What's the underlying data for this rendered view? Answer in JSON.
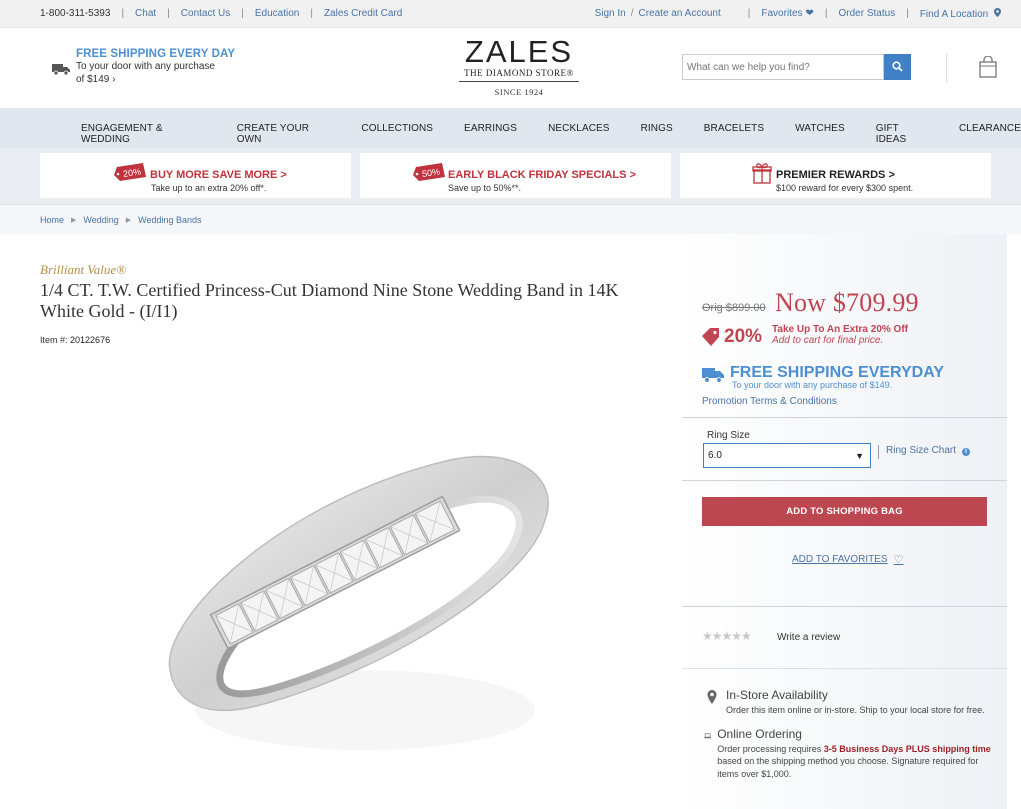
{
  "utility": {
    "phone": "1-800-311-5393",
    "links_left": [
      "Chat",
      "Contact Us",
      "Education",
      "Zales Credit Card"
    ],
    "sign_in": "Sign In",
    "slash": "/",
    "create_account": "Create an Account",
    "favorites": "Favorites",
    "order_status": "Order Status",
    "find_location": "Find A Location"
  },
  "header": {
    "shipping_title": "FREE SHIPPING EVERY DAY",
    "shipping_line1": "To your door with any purchase",
    "shipping_line2": "of $149 ›",
    "logo_name": "ZALES",
    "logo_tag": "THE DIAMOND STORE®",
    "logo_since": "SINCE 1924",
    "search_placeholder": "What can we help you find?"
  },
  "nav": [
    "ENGAGEMENT & WEDDING",
    "CREATE YOUR OWN",
    "COLLECTIONS",
    "EARRINGS",
    "NECKLACES",
    "RINGS",
    "BRACELETS",
    "WATCHES",
    "GIFT IDEAS",
    "CLEARANCE"
  ],
  "promos": [
    {
      "badge": "20%",
      "title": "BUY MORE SAVE MORE >",
      "desc": "Take up to an extra 20% off*."
    },
    {
      "badge": "50%",
      "title": "EARLY BLACK FRIDAY SPECIALS >",
      "desc": "Save up to 50%**."
    },
    {
      "badge": "gift",
      "title": "PREMIER REWARDS >",
      "desc": "$100 reward for every $300 spent."
    }
  ],
  "breadcrumb": [
    "Home",
    "Wedding",
    "Wedding Bands"
  ],
  "product": {
    "brand": "Brilliant Value®",
    "title": "1/4 CT. T.W. Certified Princess-Cut Diamond Nine Stone Wedding Band in 14K White Gold - (I/I1)",
    "item_label": "Item #:",
    "item_number": "20122676"
  },
  "pricing": {
    "orig": "Orig $899.00",
    "now": "Now $709.99",
    "pct": "20%",
    "pct_line1": "Take Up To An Extra 20% Off",
    "pct_line2": "Add to cart for final price.",
    "ship_title": "FREE SHIPPING EVERYDAY",
    "ship_sub": "To your door with any purchase of $149.",
    "terms": "Promotion Terms & Conditions"
  },
  "ring_size": {
    "label": "Ring Size",
    "value": "6.0",
    "chart_link": "Ring Size Chart"
  },
  "actions": {
    "add_to_bag": "ADD TO SHOPPING BAG",
    "add_to_favorites": "ADD TO FAVORITES"
  },
  "reviews": {
    "stars": "★★★★★",
    "write": "Write a review"
  },
  "availability": {
    "instore_title": "In-Store Availability",
    "instore_text": "Order this item online or in-store. Ship to your local store for free.",
    "online_title": "Online Ordering",
    "online_pre": "Order processing requires ",
    "online_red": "3-5 Business Days PLUS shipping time",
    "online_post": " based on the shipping method you choose. Signature required for items over $1,000."
  },
  "colors": {
    "accent_blue": "#3f80c7",
    "sale_red": "#c14452",
    "bag_button": "#bc4751",
    "brand_gold": "#b48e4a"
  }
}
